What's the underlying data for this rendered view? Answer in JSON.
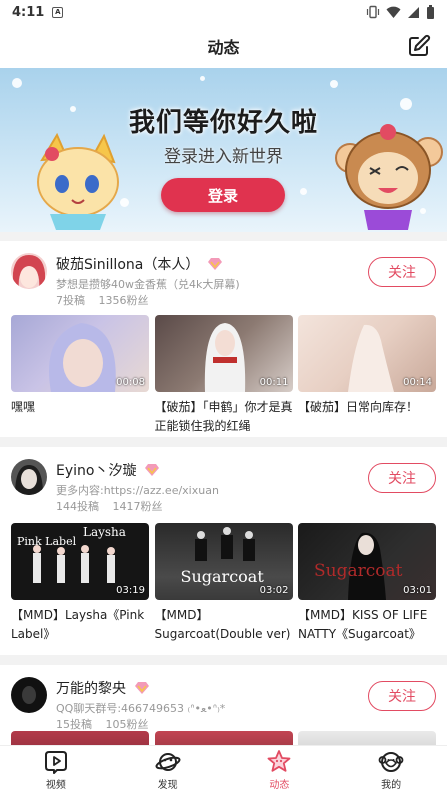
{
  "status_bar": {
    "time": "4:11",
    "notification_icon": "A"
  },
  "header": {
    "title": "动态"
  },
  "banner": {
    "headline": "我们等你好久啦",
    "subtitle": "登录进入新世界",
    "login_label": "登录"
  },
  "feed": [
    {
      "name": "破茄Sinillona（本人）",
      "signature": "梦想是攒够40w金香蕉（兑4k大屏幕)",
      "posts": "7投稿",
      "fans": "1356粉丝",
      "follow_label": "关注",
      "videos": [
        {
          "duration": "00:08",
          "title": "嘿嘿"
        },
        {
          "duration": "00:11",
          "title": "【破茄】「申鹤」你才是真正能锁住我的红绳"
        },
        {
          "duration": "00:14",
          "title": "【破茄】日常向库存！"
        }
      ]
    },
    {
      "name": "Eyino丶汐璇",
      "signature": "更多内容:https://azz.ee/xixuan",
      "posts": "144投稿",
      "fans": "1417粉丝",
      "follow_label": "关注",
      "videos": [
        {
          "duration": "03:19",
          "title": "【MMD】Laysha《Pink Label》",
          "overlay1": "Pink Label",
          "overlay2": "Laysha"
        },
        {
          "duration": "03:02",
          "title": "【MMD】Sugarcoat(Double ver)",
          "overlay1": "Sugarcoat"
        },
        {
          "duration": "03:01",
          "title": "【MMD】KISS OF LIFE NATTY《Sugarcoat》",
          "overlay1": "Sugarcoat"
        }
      ]
    },
    {
      "name": "万能的黎央",
      "signature": "QQ聊天群号:466749653 ₍ᐢ•ﻌ•ᐢ₎*",
      "posts": "15投稿",
      "fans": "105粉丝",
      "follow_label": "关注"
    }
  ],
  "bottom_nav": [
    {
      "label": "视频",
      "icon": "play-icon"
    },
    {
      "label": "发现",
      "icon": "planet-icon"
    },
    {
      "label": "动态",
      "icon": "star-icon",
      "active": true
    },
    {
      "label": "我的",
      "icon": "monkey-face-icon"
    }
  ],
  "colors": {
    "accent": "#e24b62",
    "login_button": "#e0334f"
  }
}
